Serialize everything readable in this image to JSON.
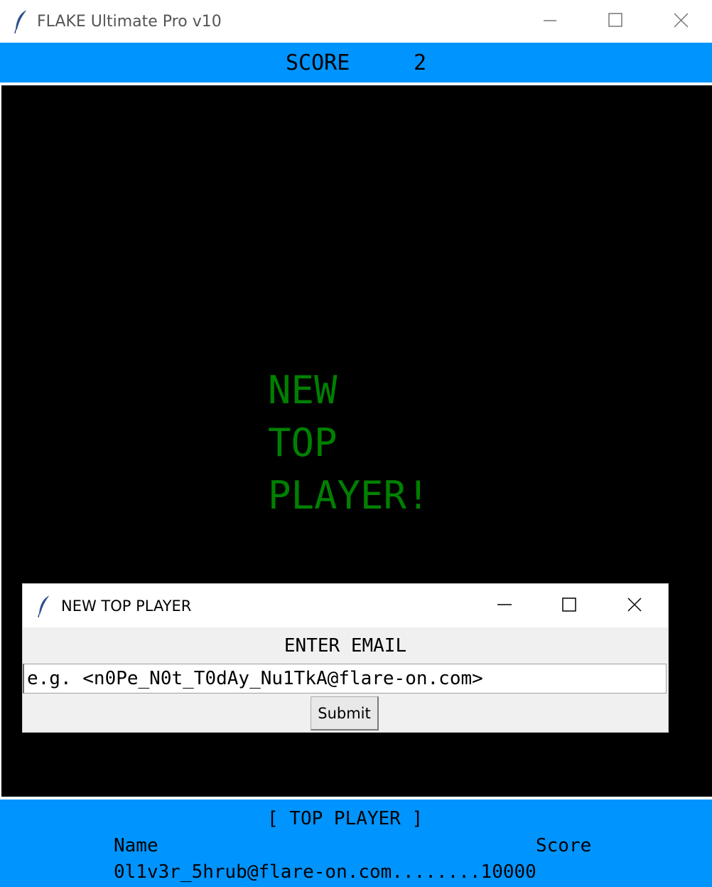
{
  "window": {
    "title": "FLAKE Ultimate Pro v10",
    "icon": "feather-icon",
    "controls": [
      "minimize-icon",
      "maximize-icon",
      "close-icon"
    ]
  },
  "scorebar": {
    "label": "SCORE",
    "value": "2",
    "background": "#0094ff"
  },
  "canvas": {
    "background": "#000000",
    "message_lines": [
      "NEW",
      "TOP",
      "PLAYER!"
    ],
    "message_color": "#008000"
  },
  "dialog": {
    "title": "NEW TOP PLAYER",
    "icon": "feather-icon",
    "prompt": "ENTER EMAIL",
    "email_placeholder": "e.g. <n0Pe_N0t_T0dAy_Nu1TkA@flare-on.com>",
    "email_value": "",
    "submit_label": "Submit"
  },
  "top_player": {
    "heading": "[ TOP PLAYER ]",
    "columns": {
      "name": "Name",
      "score": "Score"
    },
    "entry": "0l1v3r_5hrub@flare-on.com........10000",
    "background": "#0094ff"
  }
}
